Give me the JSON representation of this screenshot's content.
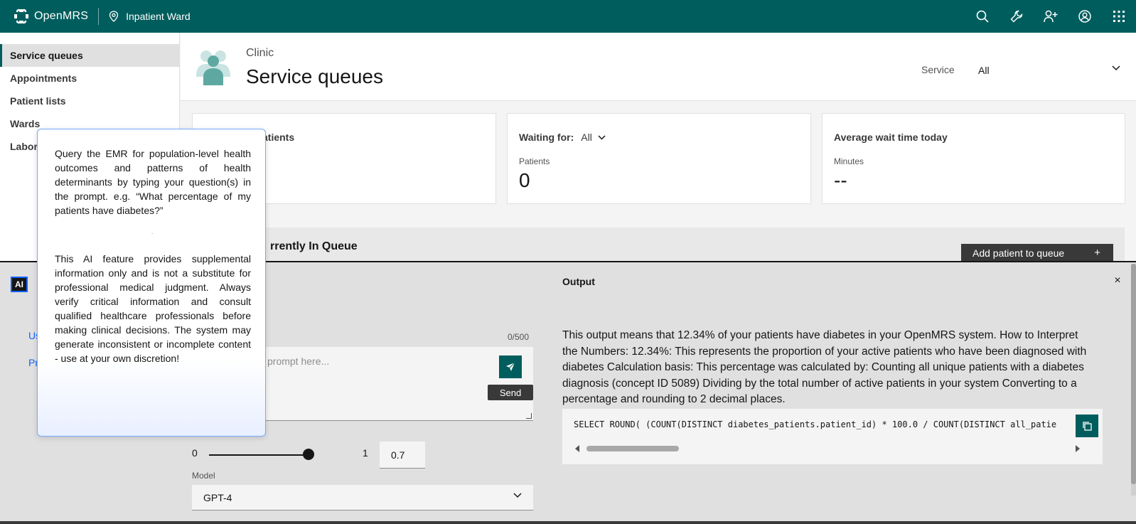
{
  "header": {
    "app_name": "OpenMRS",
    "location": "Inpatient Ward",
    "icons": [
      "search-icon",
      "wrench-icon",
      "add-user-icon",
      "user-avatar-icon",
      "app-switcher-icon"
    ],
    "color": "#005d5d"
  },
  "sidebar": {
    "items": [
      {
        "label": "Service queues",
        "active": true
      },
      {
        "label": "Appointments"
      },
      {
        "label": "Patient lists"
      },
      {
        "label": "Wards"
      },
      {
        "label": "Labor"
      }
    ]
  },
  "page_header": {
    "subtitle": "Clinic",
    "title": "Service queues",
    "service_label": "Service",
    "service_value": "All"
  },
  "cards": {
    "c1_title": "atients",
    "c2_title": "Waiting for:",
    "c2_filter": "All",
    "c2_sub": "Patients",
    "c2_value": "0",
    "c3_title": "Average wait time today",
    "c3_sub": "Minutes",
    "c3_value": "--"
  },
  "queue": {
    "title": "rrently In Queue",
    "add_button": "Add patient to queue",
    "add_icon": "+"
  },
  "ai": {
    "badge": "AI",
    "tab_u": "Us",
    "tab_p": "Pr",
    "char_count": "0/500",
    "prompt_placeholder": "prompt here...",
    "send_tooltip": "Send",
    "slider_min": "0",
    "slider_max": "1",
    "temperature": "0.7",
    "temperature_fraction": 0.7,
    "model_label": "Model",
    "model_value": "GPT-4",
    "output_title": "Output",
    "close": "×",
    "output_text": "This output means that 12.34% of your patients have diabetes in your OpenMRS system. How to Interpret the Numbers: 12.34%: This represents the proportion of your active patients who have been diagnosed with diabetes Calculation basis: This percentage was calculated by: Counting all unique patients with a diabetes diagnosis (concept ID 5089) Dividing by the total number of active patients in your system Converting to a percentage and rounding to 2 decimal places.",
    "sql": "SELECT ROUND( (COUNT(DISTINCT diabetes_patients.patient_id) * 100.0 / COUNT(DISTINCT all_patie"
  },
  "popover": {
    "p1": "Query the EMR for population-level health outcomes and patterns of health determinants by typing your question(s) in the prompt. e.g. “What percentage of my patients have diabetes?”",
    "separator": ".",
    "p2": "This AI feature provides supplemental information only and is not a substitute for professional medical judgment. Always verify critical information and consult qualified healthcare professionals before making clinical decisions. The system may generate inconsistent or incomplete content - use at your own discretion!"
  }
}
